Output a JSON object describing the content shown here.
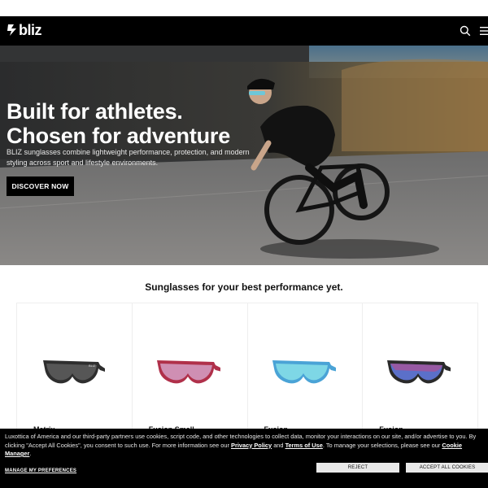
{
  "header": {
    "logo_text": "bliz",
    "icons": [
      "bliz-logo-mark-icon",
      "search-icon",
      "hamburger-menu-icon"
    ]
  },
  "hero": {
    "title_line1": "Built for athletes.",
    "title_line2": "Chosen for adventure",
    "subtitle": "BLIZ sunglasses combine lightweight performance, protection, and modern styling across sport and lifestyle environments.",
    "cta_label": "DISCOVER NOW"
  },
  "products": {
    "title": "Sunglasses for your best performance yet.",
    "items": [
      {
        "name": "Matrix",
        "lens_color": "#2f2f2f",
        "frame_color": "#3a3a3a"
      },
      {
        "name": "Fusion Small",
        "lens_color": "#c98fb0",
        "frame_color": "#b0304a"
      },
      {
        "name": "Fusion",
        "lens_color": "#6fd2e4",
        "frame_color": "#4aa3d6"
      },
      {
        "name": "Fusion",
        "lens_color": "#5b70c9",
        "frame_color": "#2a2a2a"
      }
    ]
  },
  "cookie": {
    "text_before": "Luxottica of America and our third-party partners use cookies, script code, and other technologies to collect data, monitor your interactions on our site, and/or advertise to you. By clicking \"Accept All Cookies\", you consent to such use. For more information see our ",
    "privacy_link": "Privacy Policy",
    "and": " and ",
    "terms_link": "Terms of Use",
    "text_mid": ". To manage your selections, please see our ",
    "cookie_manager_link": "Cookie Manager",
    "text_end": ".",
    "manage_label": "MANAGE MY PREFERENCES",
    "reject_label": "REJECT",
    "accept_label": "ACCEPT ALL COOKIES"
  },
  "colors": {
    "header_bg": "#000000",
    "cookie_bg": "#000000",
    "cta_bg": "#000000"
  }
}
